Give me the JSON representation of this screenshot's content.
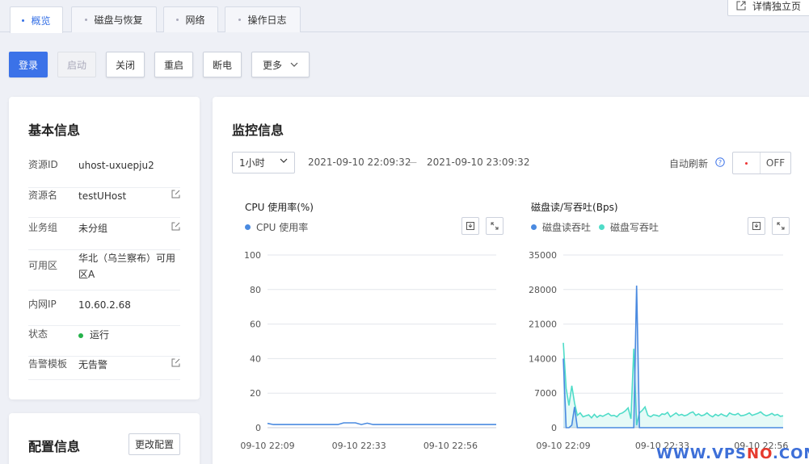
{
  "tabs": [
    {
      "label": "概览",
      "active": true
    },
    {
      "label": "磁盘与恢复",
      "active": false
    },
    {
      "label": "网络",
      "active": false
    },
    {
      "label": "操作日志",
      "active": false
    }
  ],
  "detail_button": "详情独立页",
  "toolbar": {
    "login": "登录",
    "start": "启动",
    "stop": "关闭",
    "restart": "重启",
    "poweroff": "断电",
    "more": "更多"
  },
  "basic_info": {
    "title": "基本信息",
    "rows": [
      {
        "key": "资源ID",
        "value": "uhost-uxuepju2"
      },
      {
        "key": "资源名",
        "value": "testUHost"
      },
      {
        "key": "业务组",
        "value": "未分组"
      },
      {
        "key": "可用区",
        "value": "华北（乌兰察布）可用区A"
      },
      {
        "key": "内网IP",
        "value": "10.60.2.68"
      },
      {
        "key": "状态",
        "value": "运行"
      },
      {
        "key": "告警模板",
        "value": "无告警"
      }
    ]
  },
  "config_info": {
    "title": "配置信息",
    "change_button": "更改配置"
  },
  "monitor": {
    "title": "监控信息",
    "range_select": "1小时",
    "start_time": "2021-09-10 22:09:32",
    "separator": "—",
    "end_time": "2021-09-10 23:09:32",
    "auto_refresh_label": "自动刷新",
    "toggle_state": "OFF"
  },
  "colors": {
    "primary": "#3b72e8",
    "cpu_line": "#4a8ae0",
    "disk_read": "#4a8ae0",
    "disk_write": "#4fdcc8",
    "status_running": "#25b24a"
  },
  "chart_data": [
    {
      "type": "line",
      "title": "CPU 使用率(%)",
      "series": [
        {
          "name": "CPU 使用率",
          "values": [
            2.5,
            1.8,
            1.8,
            1.8,
            1.8,
            1.8,
            1.8,
            1.8,
            1.8,
            1.8,
            1.8,
            1.8,
            1.8,
            2.8,
            2.8,
            2.8,
            1.8,
            2.6,
            1.8,
            1.8,
            1.8,
            1.8,
            1.8,
            1.8,
            1.8,
            1.8,
            1.8,
            1.8,
            1.8,
            1.8,
            1.8,
            1.8,
            1.8,
            1.8,
            1.8,
            1.8,
            1.8,
            1.8,
            1.8,
            1.8
          ]
        }
      ],
      "x_ticks": [
        "09-10 22:09",
        "09-10 22:33",
        "09-10 22:56"
      ],
      "y_ticks": [
        0,
        20,
        40,
        60,
        80,
        100
      ],
      "ylim": [
        0,
        100
      ]
    },
    {
      "type": "area",
      "title": "磁盘读/写吞吐(Bps)",
      "series": [
        {
          "name": "磁盘读吞吐",
          "values": [
            14000,
            0,
            0,
            500,
            4200,
            0,
            0,
            0,
            0,
            0,
            0,
            0,
            0,
            0,
            0,
            0,
            0,
            0,
            0,
            0,
            0,
            0,
            0,
            0,
            0,
            0,
            28800,
            0,
            0,
            0,
            0,
            0,
            0,
            0,
            0,
            0,
            0,
            0,
            0,
            0,
            0,
            0,
            0,
            0,
            0,
            0,
            0,
            0,
            0,
            0,
            0,
            0,
            0,
            0,
            0,
            0,
            0,
            0,
            0,
            0,
            0,
            0,
            0,
            0,
            0,
            0,
            0,
            0,
            0,
            0,
            0,
            0,
            0,
            0,
            0,
            0,
            0,
            0,
            0
          ]
        },
        {
          "name": "磁盘写吞吐",
          "values": [
            17200,
            8000,
            4500,
            8500,
            5000,
            2500,
            3000,
            2200,
            2400,
            2600,
            2000,
            2700,
            2100,
            2500,
            2300,
            2600,
            2900,
            2400,
            2500,
            2200,
            2800,
            3000,
            3400,
            4000,
            1800,
            16000,
            500,
            3000,
            3500,
            4200,
            2500,
            2200,
            2600,
            2500,
            2300,
            2800,
            2700,
            3100,
            2200,
            2600,
            3000,
            2500,
            2700,
            2400,
            2600,
            3000,
            3200,
            2500,
            2800,
            2400,
            2600,
            3000,
            2500,
            2200,
            2700,
            2400,
            2800,
            2500,
            2300,
            3000,
            2700,
            2600,
            2900,
            2400,
            2500,
            2700,
            3000,
            2500,
            2700,
            2900,
            3200,
            2700,
            2400,
            2600,
            2900,
            2500,
            2700,
            2300,
            2400
          ]
        }
      ],
      "x_ticks": [
        "09-10 22:09",
        "09-10 22:33",
        "09-10 22:56"
      ],
      "y_ticks": [
        0,
        7000,
        14000,
        21000,
        28000,
        35000
      ],
      "ylim": [
        0,
        35000
      ]
    }
  ],
  "watermark": {
    "prefix": "WWW.",
    "vps": "VPS",
    "no": "NO",
    "suffix": ".COM"
  }
}
